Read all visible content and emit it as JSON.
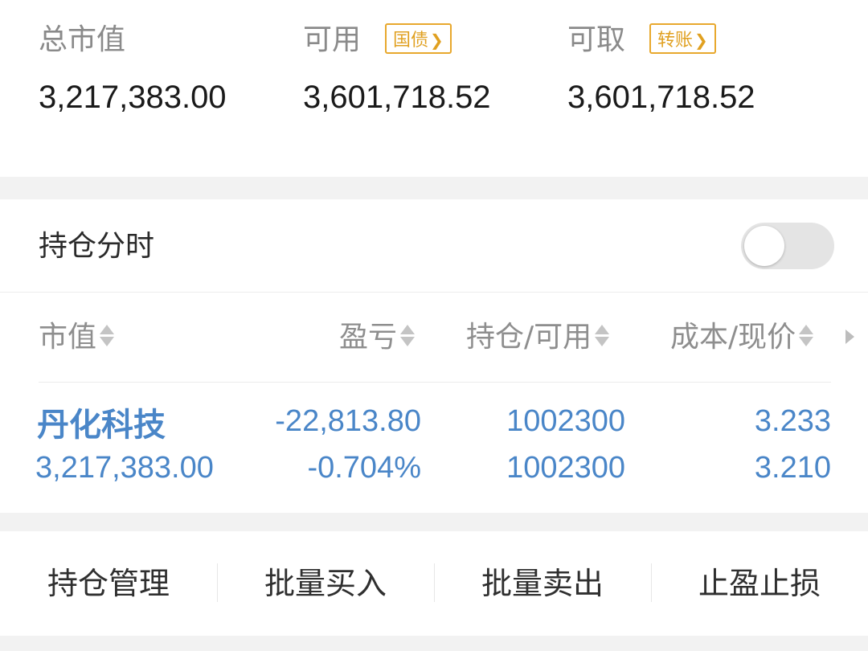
{
  "summary": {
    "market_value": {
      "label": "总市值",
      "value": "3,217,383.00"
    },
    "available": {
      "label": "可用",
      "value": "3,601,718.52",
      "tag": "国债"
    },
    "withdrawable": {
      "label": "可取",
      "value": "3,601,718.52",
      "tag": "转账"
    }
  },
  "holdings": {
    "title": "持仓分时",
    "toggle_on": false,
    "columns": [
      "市值",
      "盈亏",
      "持仓/可用",
      "成本/现价"
    ],
    "rows": [
      {
        "name": "丹化科技",
        "market_value": "3,217,383.00",
        "pnl": "-22,813.80",
        "pnl_pct": "-0.704%",
        "position": "1002300",
        "available": "1002300",
        "cost": "3.233",
        "price": "3.210"
      }
    ]
  },
  "actions": [
    "持仓管理",
    "批量买入",
    "批量卖出",
    "止盈止损"
  ],
  "colors": {
    "accent_blue": "#4a86c8",
    "tag_orange": "#e8a82d",
    "label_gray": "#8a8a8a"
  }
}
